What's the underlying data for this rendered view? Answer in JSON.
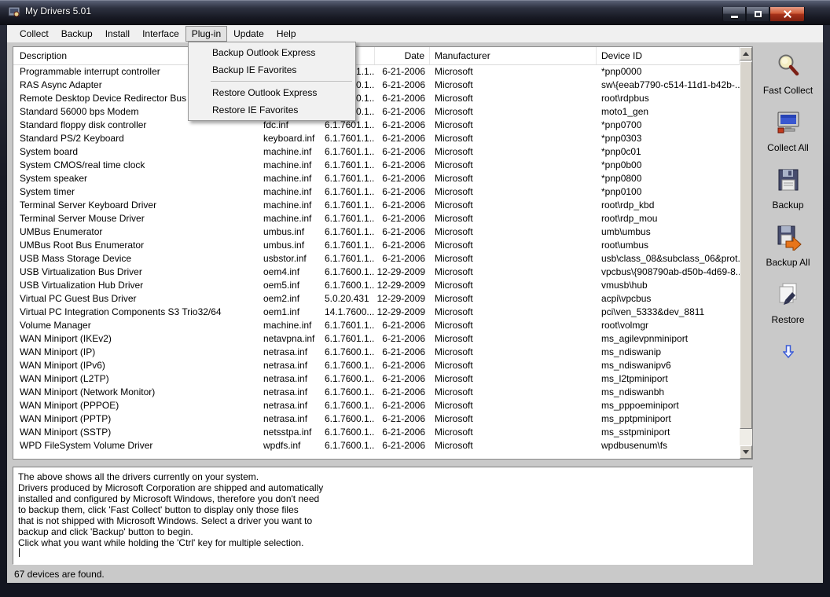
{
  "window": {
    "title": "My Drivers 5.01"
  },
  "colors": {
    "titlebar": "#171923",
    "close_button": "#a6311a",
    "menu_bg": "#f0f0f0",
    "content_bg": "#c9c9c9",
    "screen_blue": "#3a57d0",
    "backup_all_arrow": "#e8751a"
  },
  "menubar": {
    "items": [
      "Collect",
      "Backup",
      "Install",
      "Interface",
      "Plug-in",
      "Update",
      "Help"
    ],
    "active_item": "Plug-in"
  },
  "plugin_menu": {
    "items": [
      "Backup Outlook Express",
      "Backup IE Favorites",
      "Restore Outlook Express",
      "Restore IE Favorites"
    ]
  },
  "table": {
    "columns": [
      "Description",
      "",
      "",
      "Date",
      "Manufacturer",
      "Device ID"
    ],
    "rows": [
      {
        "description": "Programmable interrupt controller",
        "inf": "",
        "version": "6.1.7601.1...",
        "date": "6-21-2006",
        "manufacturer": "Microsoft",
        "device_id": "*pnp0000"
      },
      {
        "description": "RAS Async Adapter",
        "inf": "",
        "version": "6.1.7600.1...",
        "date": "6-21-2006",
        "manufacturer": "Microsoft",
        "device_id": "sw\\{eeab7790-c514-11d1-b42b-..."
      },
      {
        "description": "Remote Desktop Device Redirector Bus",
        "inf": "",
        "version": "6.1.7600.1...",
        "date": "6-21-2006",
        "manufacturer": "Microsoft",
        "device_id": "root\\rdpbus"
      },
      {
        "description": "Standard 56000 bps Modem",
        "inf": "",
        "version": "6.1.7600.1...",
        "date": "6-21-2006",
        "manufacturer": "Microsoft",
        "device_id": "moto1_gen"
      },
      {
        "description": "Standard floppy disk controller",
        "inf": "fdc.inf",
        "version": "6.1.7601.1...",
        "date": "6-21-2006",
        "manufacturer": "Microsoft",
        "device_id": "*pnp0700"
      },
      {
        "description": "Standard PS/2 Keyboard",
        "inf": "keyboard.inf",
        "version": "6.1.7601.1...",
        "date": "6-21-2006",
        "manufacturer": "Microsoft",
        "device_id": "*pnp0303"
      },
      {
        "description": "System board",
        "inf": "machine.inf",
        "version": "6.1.7601.1...",
        "date": "6-21-2006",
        "manufacturer": "Microsoft",
        "device_id": "*pnp0c01"
      },
      {
        "description": "System CMOS/real time clock",
        "inf": "machine.inf",
        "version": "6.1.7601.1...",
        "date": "6-21-2006",
        "manufacturer": "Microsoft",
        "device_id": "*pnp0b00"
      },
      {
        "description": "System speaker",
        "inf": "machine.inf",
        "version": "6.1.7601.1...",
        "date": "6-21-2006",
        "manufacturer": "Microsoft",
        "device_id": "*pnp0800"
      },
      {
        "description": "System timer",
        "inf": "machine.inf",
        "version": "6.1.7601.1...",
        "date": "6-21-2006",
        "manufacturer": "Microsoft",
        "device_id": "*pnp0100"
      },
      {
        "description": "Terminal Server Keyboard Driver",
        "inf": "machine.inf",
        "version": "6.1.7601.1...",
        "date": "6-21-2006",
        "manufacturer": "Microsoft",
        "device_id": "root\\rdp_kbd"
      },
      {
        "description": "Terminal Server Mouse Driver",
        "inf": "machine.inf",
        "version": "6.1.7601.1...",
        "date": "6-21-2006",
        "manufacturer": "Microsoft",
        "device_id": "root\\rdp_mou"
      },
      {
        "description": "UMBus Enumerator",
        "inf": "umbus.inf",
        "version": "6.1.7601.1...",
        "date": "6-21-2006",
        "manufacturer": "Microsoft",
        "device_id": "umb\\umbus"
      },
      {
        "description": "UMBus Root Bus Enumerator",
        "inf": "umbus.inf",
        "version": "6.1.7601.1...",
        "date": "6-21-2006",
        "manufacturer": "Microsoft",
        "device_id": "root\\umbus"
      },
      {
        "description": "USB Mass Storage Device",
        "inf": "usbstor.inf",
        "version": "6.1.7601.1...",
        "date": "6-21-2006",
        "manufacturer": "Microsoft",
        "device_id": "usb\\class_08&subclass_06&prot..."
      },
      {
        "description": "USB Virtualization Bus Driver",
        "inf": "oem4.inf",
        "version": "6.1.7600.1...",
        "date": "12-29-2009",
        "manufacturer": "Microsoft",
        "device_id": "vpcbus\\{908790ab-d50b-4d69-8..."
      },
      {
        "description": "USB Virtualization Hub Driver",
        "inf": "oem5.inf",
        "version": "6.1.7600.1...",
        "date": "12-29-2009",
        "manufacturer": "Microsoft",
        "device_id": "vmusb\\hub"
      },
      {
        "description": "Virtual PC Guest Bus Driver",
        "inf": "oem2.inf",
        "version": "5.0.20.431",
        "date": "12-29-2009",
        "manufacturer": "Microsoft",
        "device_id": "acpi\\vpcbus"
      },
      {
        "description": "Virtual PC Integration Components S3 Trio32/64",
        "inf": "oem1.inf",
        "version": "14.1.7600...",
        "date": "12-29-2009",
        "manufacturer": "Microsoft",
        "device_id": "pci\\ven_5333&dev_8811"
      },
      {
        "description": "Volume Manager",
        "inf": "machine.inf",
        "version": "6.1.7601.1...",
        "date": "6-21-2006",
        "manufacturer": "Microsoft",
        "device_id": "root\\volmgr"
      },
      {
        "description": "WAN Miniport (IKEv2)",
        "inf": "netavpna.inf",
        "version": "6.1.7601.1...",
        "date": "6-21-2006",
        "manufacturer": "Microsoft",
        "device_id": "ms_agilevpnminiport"
      },
      {
        "description": "WAN Miniport (IP)",
        "inf": "netrasa.inf",
        "version": "6.1.7600.1...",
        "date": "6-21-2006",
        "manufacturer": "Microsoft",
        "device_id": "ms_ndiswanip"
      },
      {
        "description": "WAN Miniport (IPv6)",
        "inf": "netrasa.inf",
        "version": "6.1.7600.1...",
        "date": "6-21-2006",
        "manufacturer": "Microsoft",
        "device_id": "ms_ndiswanipv6"
      },
      {
        "description": "WAN Miniport (L2TP)",
        "inf": "netrasa.inf",
        "version": "6.1.7600.1...",
        "date": "6-21-2006",
        "manufacturer": "Microsoft",
        "device_id": "ms_l2tpminiport"
      },
      {
        "description": "WAN Miniport (Network Monitor)",
        "inf": "netrasa.inf",
        "version": "6.1.7600.1...",
        "date": "6-21-2006",
        "manufacturer": "Microsoft",
        "device_id": "ms_ndiswanbh"
      },
      {
        "description": "WAN Miniport (PPPOE)",
        "inf": "netrasa.inf",
        "version": "6.1.7600.1...",
        "date": "6-21-2006",
        "manufacturer": "Microsoft",
        "device_id": "ms_pppoeminiport"
      },
      {
        "description": "WAN Miniport (PPTP)",
        "inf": "netrasa.inf",
        "version": "6.1.7600.1...",
        "date": "6-21-2006",
        "manufacturer": "Microsoft",
        "device_id": "ms_pptpminiport"
      },
      {
        "description": "WAN Miniport (SSTP)",
        "inf": "netsstpa.inf",
        "version": "6.1.7600.1...",
        "date": "6-21-2006",
        "manufacturer": "Microsoft",
        "device_id": "ms_sstpminiport"
      },
      {
        "description": "WPD FileSystem Volume Driver",
        "inf": "wpdfs.inf",
        "version": "6.1.7600.1...",
        "date": "6-21-2006",
        "manufacturer": "Microsoft",
        "device_id": "wpdbusenum\\fs"
      }
    ]
  },
  "sidebar": {
    "buttons": [
      {
        "label": "Fast Collect",
        "icon": "magnifier-icon"
      },
      {
        "label": "Collect All",
        "icon": "monitor-icon"
      },
      {
        "label": "Backup",
        "icon": "floppy-icon"
      },
      {
        "label": "Backup All",
        "icon": "floppy-arrow-icon"
      },
      {
        "label": "Restore",
        "icon": "restore-icon"
      }
    ],
    "scroll_hint_icon": "down-arrow-icon"
  },
  "info_panel": {
    "lines": [
      "The above shows all the drivers currently on your system.",
      "Drivers produced by Microsoft Corporation are shipped and automatically",
      "installed and configured by Microsoft Windows, therefore you don't need",
      "to backup them, click 'Fast Collect' button to display only those files",
      "that is not shipped with Microsoft Windows. Select a driver you want to",
      "backup and click 'Backup' button to begin.",
      "Click what you want while holding the 'Ctrl' key for multiple selection."
    ]
  },
  "statusbar": {
    "text": "67 devices are found."
  }
}
